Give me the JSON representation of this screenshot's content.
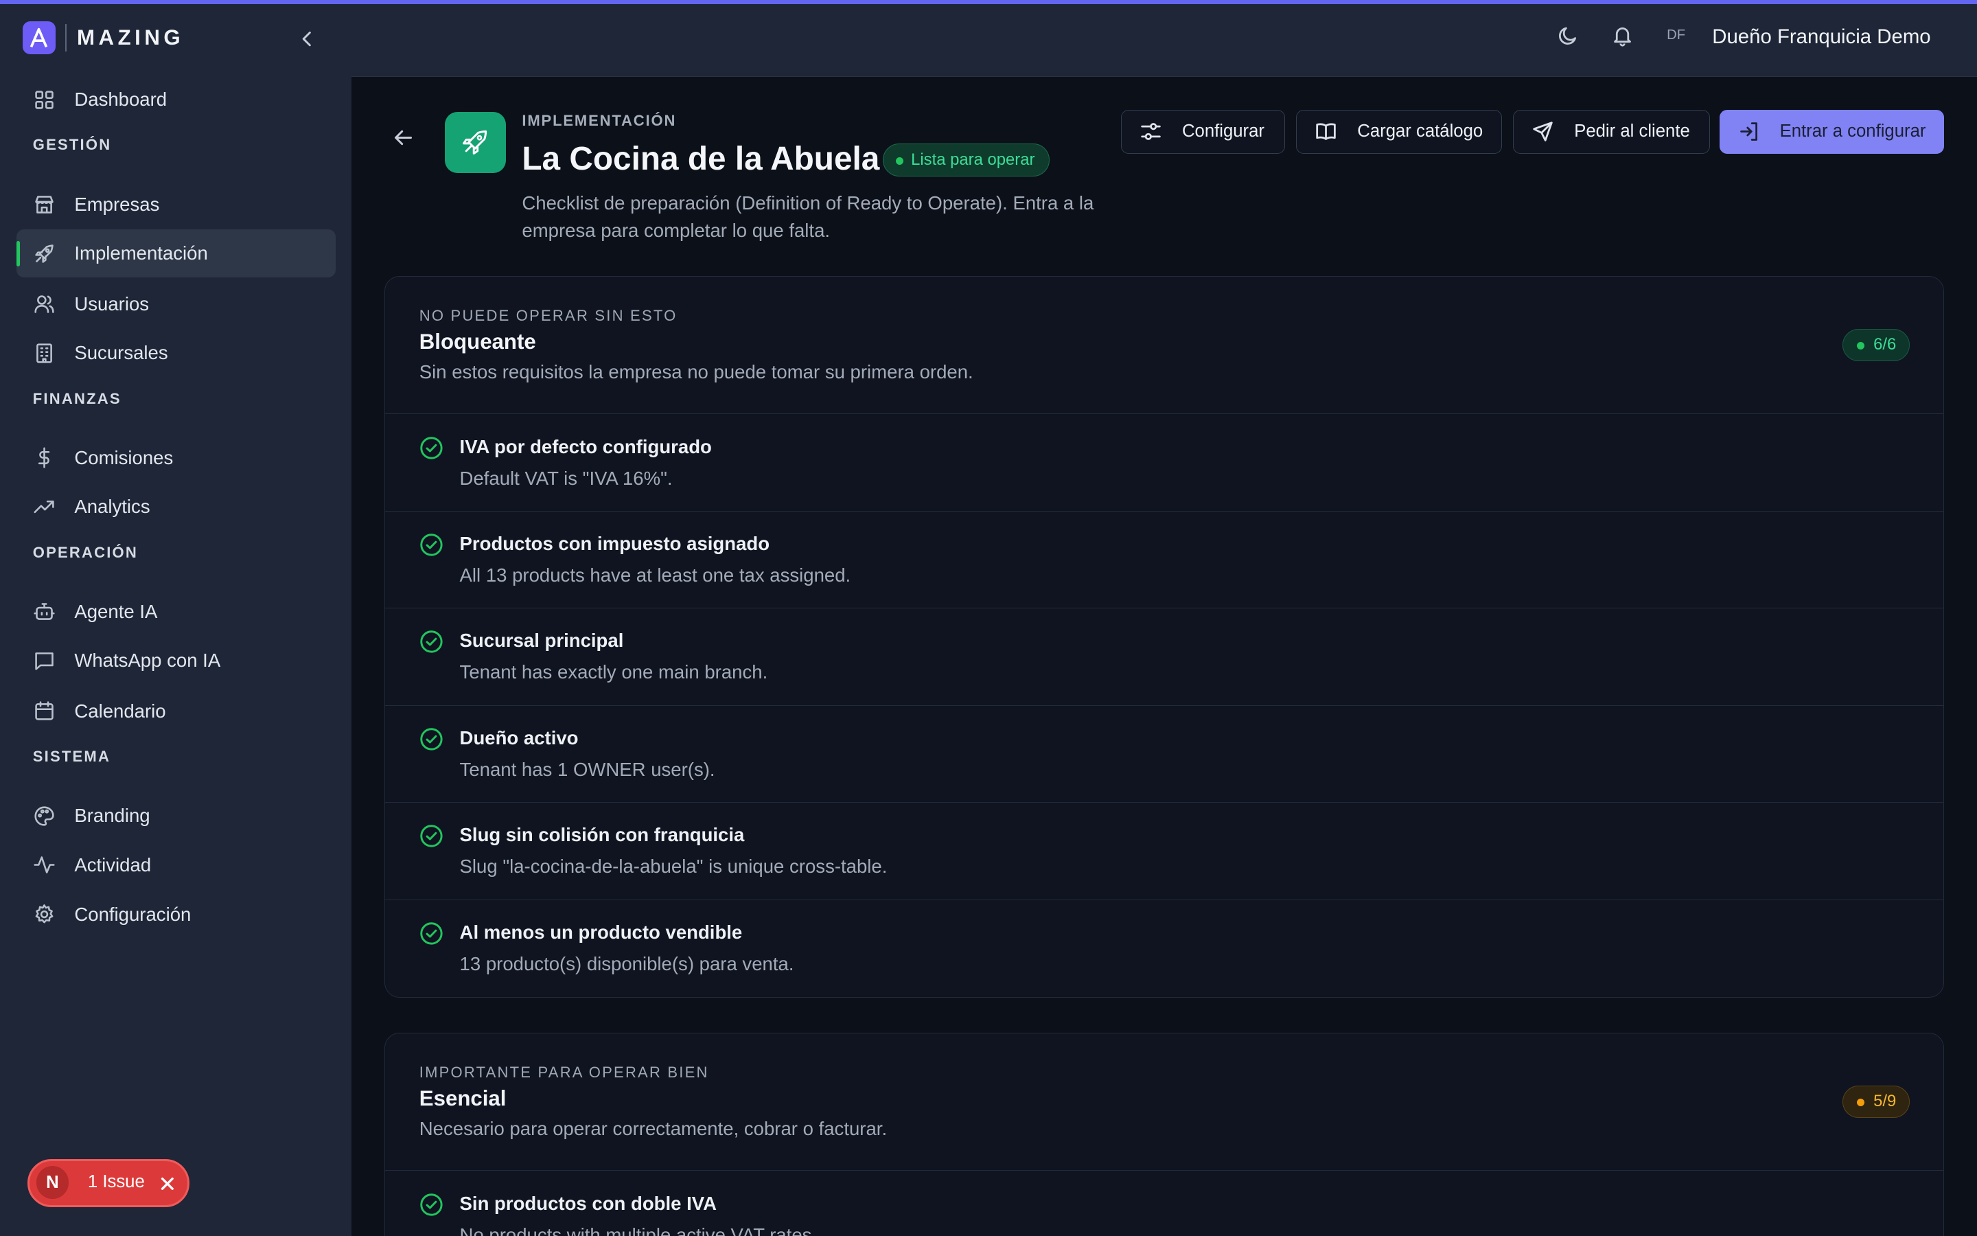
{
  "brand": {
    "logo_letter": "A",
    "name": "MAZING"
  },
  "sidebar": {
    "items": [
      {
        "label": "Dashboard",
        "icon": "grid-icon"
      },
      {
        "section": "GESTIÓN"
      },
      {
        "label": "Empresas",
        "icon": "store-icon"
      },
      {
        "label": "Implementación",
        "icon": "rocket-icon",
        "active": true
      },
      {
        "label": "Usuarios",
        "icon": "users-icon"
      },
      {
        "label": "Sucursales",
        "icon": "building-icon"
      },
      {
        "section": "FINANZAS"
      },
      {
        "label": "Comisiones",
        "icon": "dollar-icon"
      },
      {
        "label": "Analytics",
        "icon": "trending-up-icon"
      },
      {
        "section": "OPERACIÓN"
      },
      {
        "label": "Agente IA",
        "icon": "bot-icon"
      },
      {
        "label": "WhatsApp con IA",
        "icon": "message-icon"
      },
      {
        "label": "Calendario",
        "icon": "calendar-icon"
      },
      {
        "section": "SISTEMA"
      },
      {
        "label": "Branding",
        "icon": "palette-icon"
      },
      {
        "label": "Actividad",
        "icon": "activity-icon"
      },
      {
        "label": "Configuración",
        "icon": "gear-icon"
      }
    ]
  },
  "header": {
    "avatar_initials": "DF",
    "user_name": "Dueño Franquicia Demo"
  },
  "issues": {
    "badge_letter": "N",
    "label": "1 Issue"
  },
  "page": {
    "eyebrow": "IMPLEMENTACIÓN",
    "title": "La Cocina de la Abuela",
    "status": "Lista para operar",
    "description": "Checklist de preparación (Definition of Ready to Operate). Entra a la empresa para completar lo que falta."
  },
  "actions": {
    "configurar": "Configurar",
    "cargar_catalogo": "Cargar catálogo",
    "pedir_cliente": "Pedir al cliente",
    "entrar_configurar": "Entrar a configurar"
  },
  "sections": [
    {
      "eyebrow": "NO PUEDE OPERAR SIN ESTO",
      "title": "Bloqueante",
      "subtitle": "Sin estos requisitos la empresa no puede tomar su primera orden.",
      "count": "6/6",
      "status": "ok",
      "items": [
        {
          "title": "IVA por defecto configurado",
          "detail": "Default VAT is \"IVA 16%\"."
        },
        {
          "title": "Productos con impuesto asignado",
          "detail": "All 13 products have at least one tax assigned."
        },
        {
          "title": "Sucursal principal",
          "detail": "Tenant has exactly one main branch."
        },
        {
          "title": "Dueño activo",
          "detail": "Tenant has 1 OWNER user(s)."
        },
        {
          "title": "Slug sin colisión con franquicia",
          "detail": "Slug \"la-cocina-de-la-abuela\" is unique cross-table."
        },
        {
          "title": "Al menos un producto vendible",
          "detail": "13 producto(s) disponible(s) para venta."
        }
      ]
    },
    {
      "eyebrow": "IMPORTANTE PARA OPERAR BIEN",
      "title": "Esencial",
      "subtitle": "Necesario para operar correctamente, cobrar o facturar.",
      "count": "5/9",
      "status": "warn",
      "items": [
        {
          "title": "Sin productos con doble IVA",
          "detail": "No products with multiple active VAT rates."
        }
      ]
    }
  ],
  "colors": {
    "accent": "#6366f1",
    "primary_button": "#8183f4",
    "success": "#22c55e",
    "warning": "#f59e0b",
    "rocket_tile": "#16a373"
  }
}
